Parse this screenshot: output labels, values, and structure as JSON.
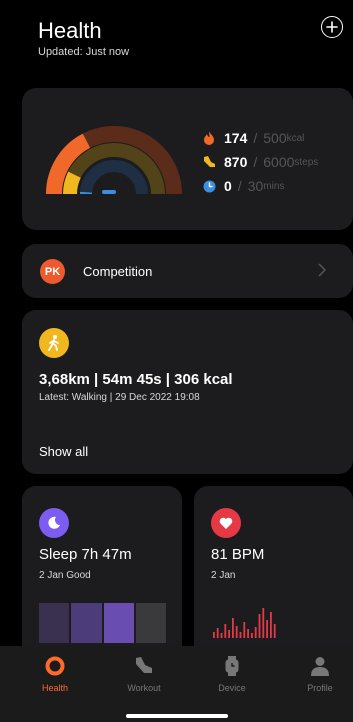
{
  "header": {
    "title": "Health",
    "updated": "Updated: Just now",
    "add_icon": "plus-circle-icon"
  },
  "activity": {
    "rings": [
      {
        "name": "calories",
        "fraction": 0.348,
        "color": "#f0692b",
        "track": "#5b2c19"
      },
      {
        "name": "steps",
        "fraction": 0.145,
        "color": "#f0b81e",
        "track": "#524319"
      },
      {
        "name": "minutes",
        "fraction": 0.02,
        "color": "#3a8fe0",
        "track": "#1e2f44"
      }
    ],
    "stats": [
      {
        "icon": "flame-icon",
        "icon_color": "#f0692b",
        "value": "174",
        "goal": "500",
        "unit": "kcal"
      },
      {
        "icon": "shoe-icon",
        "icon_color": "#f0b81e",
        "value": "870",
        "goal": "6000",
        "unit": "steps"
      },
      {
        "icon": "clock-icon",
        "icon_color": "#3a8fe0",
        "value": "0",
        "goal": "30",
        "unit": "mins"
      }
    ],
    "separator": "/"
  },
  "competition": {
    "badge": "PK",
    "label": "Competition",
    "chevron_icon": "chevron-right-icon"
  },
  "workout": {
    "icon": "walking-icon",
    "summary": "3,68km | 54m 45s | 306 kcal",
    "latest": "Latest: Walking | 29 Dec 2022 19:08",
    "show_all": "Show all"
  },
  "sleep": {
    "icon": "moon-icon",
    "title": "Sleep 7h 47m",
    "sub": "2 Jan Good",
    "bars": [
      "#3a3050",
      "#4c3d7a",
      "#6a4db0",
      "#3a3a3c"
    ]
  },
  "heart": {
    "icon": "heart-icon",
    "title": "81 BPM",
    "sub": "2 Jan",
    "color": "#e63946"
  },
  "tabs": [
    {
      "label": "Health",
      "icon": "health-ring-icon",
      "active": true
    },
    {
      "label": "Workout",
      "icon": "shoe-icon",
      "active": false
    },
    {
      "label": "Device",
      "icon": "watch-icon",
      "active": false
    },
    {
      "label": "Profile",
      "icon": "user-icon",
      "active": false
    }
  ]
}
